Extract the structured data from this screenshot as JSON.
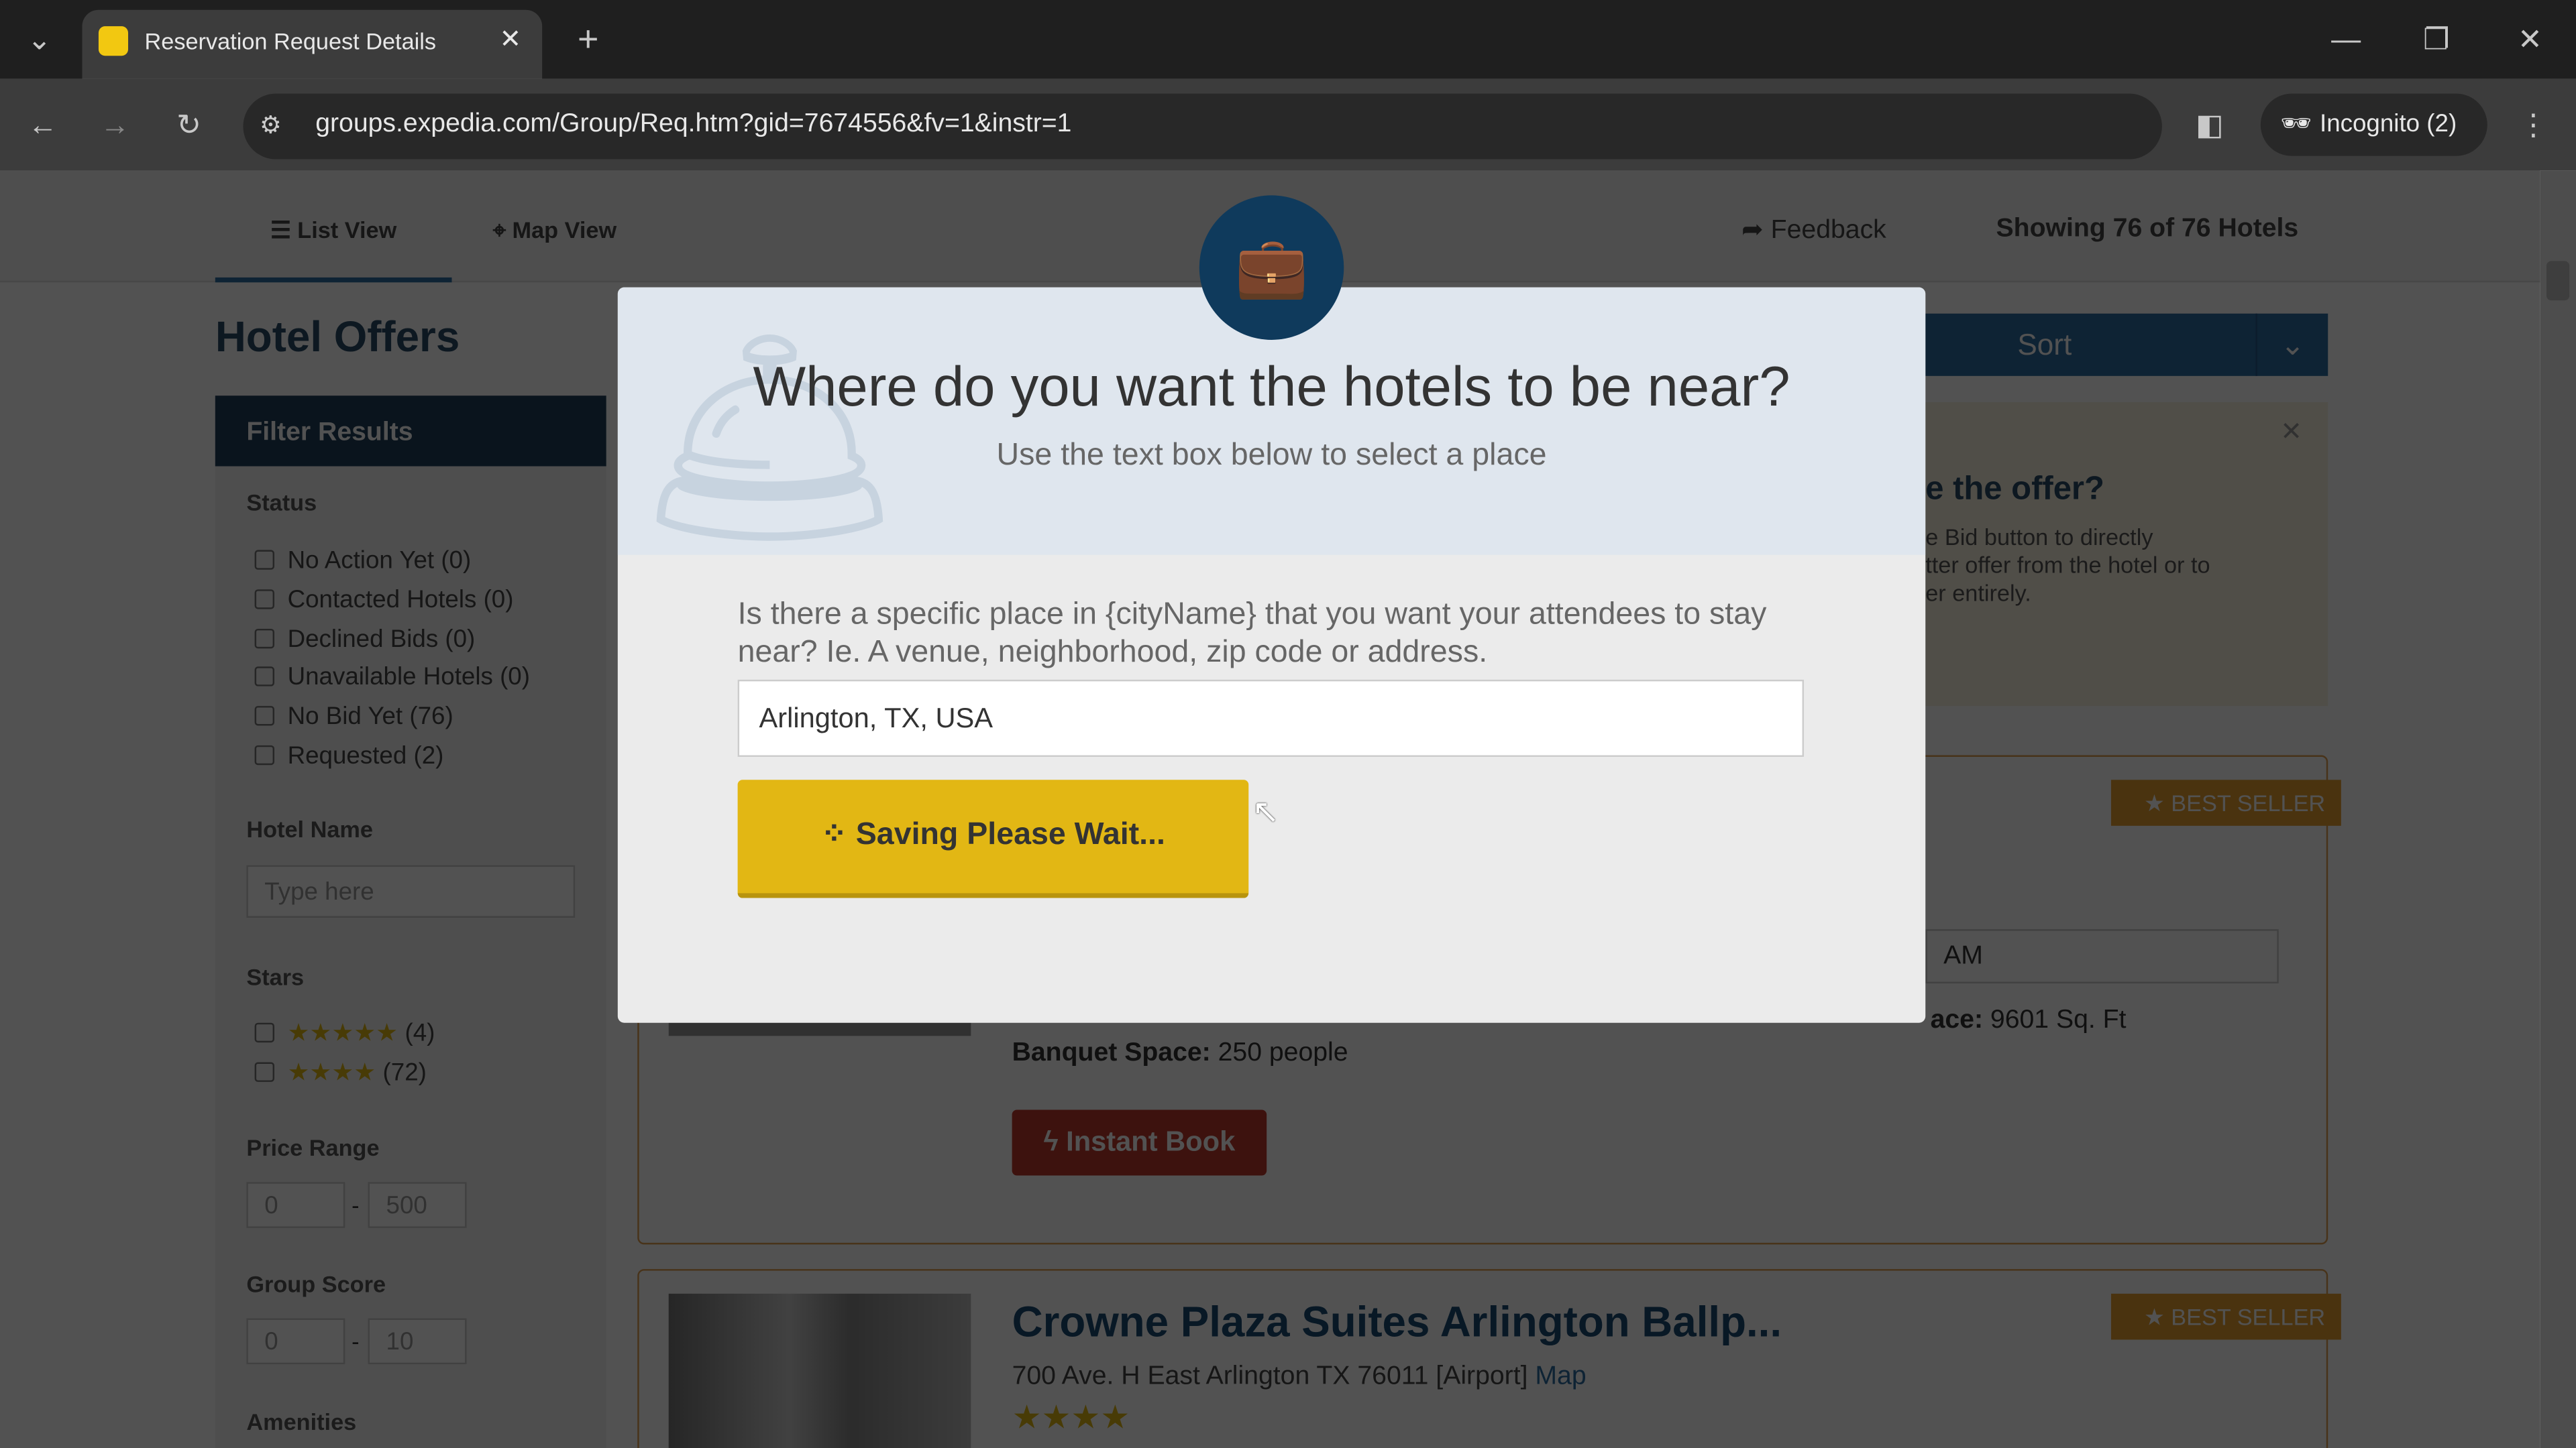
{
  "browser": {
    "tab_title": "Reservation Request Details",
    "url": "groups.expedia.com/Group/Req.htm?gid=7674556&fv=1&instr=1",
    "profile": "Incognito (2)"
  },
  "nav": {
    "list_view": "List View",
    "map_view": "Map View",
    "feedback": "Feedback",
    "showing": "Showing 76 of 76 Hotels"
  },
  "page_title": "Hotel Offers",
  "filters": {
    "header": "Filter Results",
    "status_label": "Status",
    "status": [
      "No Action Yet (0)",
      "Contacted Hotels (0)",
      "Declined Bids (0)",
      "Unavailable Hotels (0)",
      "No Bid Yet (76)",
      "Requested (2)"
    ],
    "hotel_name_label": "Hotel Name",
    "hotel_name_placeholder": "Type here",
    "stars_label": "Stars",
    "stars": [
      {
        "stars": 5,
        "count": "(4)"
      },
      {
        "stars": 4,
        "count": "(72)"
      }
    ],
    "price_label": "Price Range",
    "price_min": "0",
    "price_max": "500",
    "score_label": "Group Score",
    "score_min": "0",
    "score_max": "10",
    "amenities_label": "Amenities"
  },
  "sort": {
    "label": "Sort"
  },
  "info_box": {
    "title": "e the offer?",
    "text": "e Bid button to directly\ntter offer from the hotel or to\ner entirely."
  },
  "hotel1": {
    "badge": "BEST SELLER",
    "time_value": "AM",
    "meeting_space_label": "ace:",
    "meeting_space": "9601 Sq. Ft",
    "banquet_label": "Banquet Space:",
    "banquet": "250 people",
    "instant_book": "Instant Book"
  },
  "hotel2": {
    "badge": "BEST SELLER",
    "name": "Crowne Plaza Suites Arlington Ballp...",
    "address": "700 Ave. H East Arlington TX 76011 [Airport]",
    "map_link": "Map",
    "stars": 4
  },
  "modal": {
    "title": "Where do you want the hotels to be near?",
    "subtitle": "Use the text box below to select a place",
    "question": "Is there a specific place in {cityName} that you want your attendees to stay near? Ie. A venue, neighborhood, zip code or address.",
    "place_value": "Arlington, TX, USA",
    "save_button": "Saving Please Wait..."
  },
  "colors": {
    "brand_dark": "#0f3a5c",
    "button_yellow": "#e2b714",
    "sort_blue": "#2d6ca2",
    "instant_red": "#c0392b"
  }
}
